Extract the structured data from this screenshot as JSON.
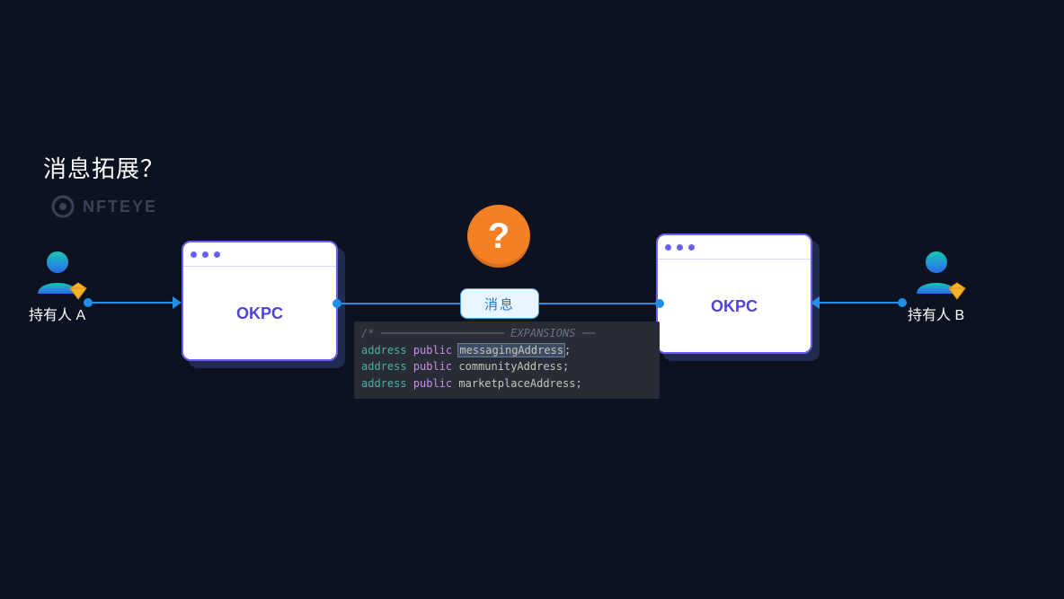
{
  "title": "消息拓展？",
  "logo_text": "NFTEYE",
  "holder_a_label": "持有人 A",
  "holder_b_label": "持有人 B",
  "window_label": "OKPC",
  "message_label": "消息",
  "question_mark": "?",
  "code": {
    "comment": "/* ─────────────────── EXPANSIONS ──",
    "kw_address": "address",
    "kw_public": "public",
    "id_messaging": "messagingAddress",
    "id_community": "communityAddress;",
    "id_marketplace": "marketplaceAddress;",
    "semi": ";"
  }
}
